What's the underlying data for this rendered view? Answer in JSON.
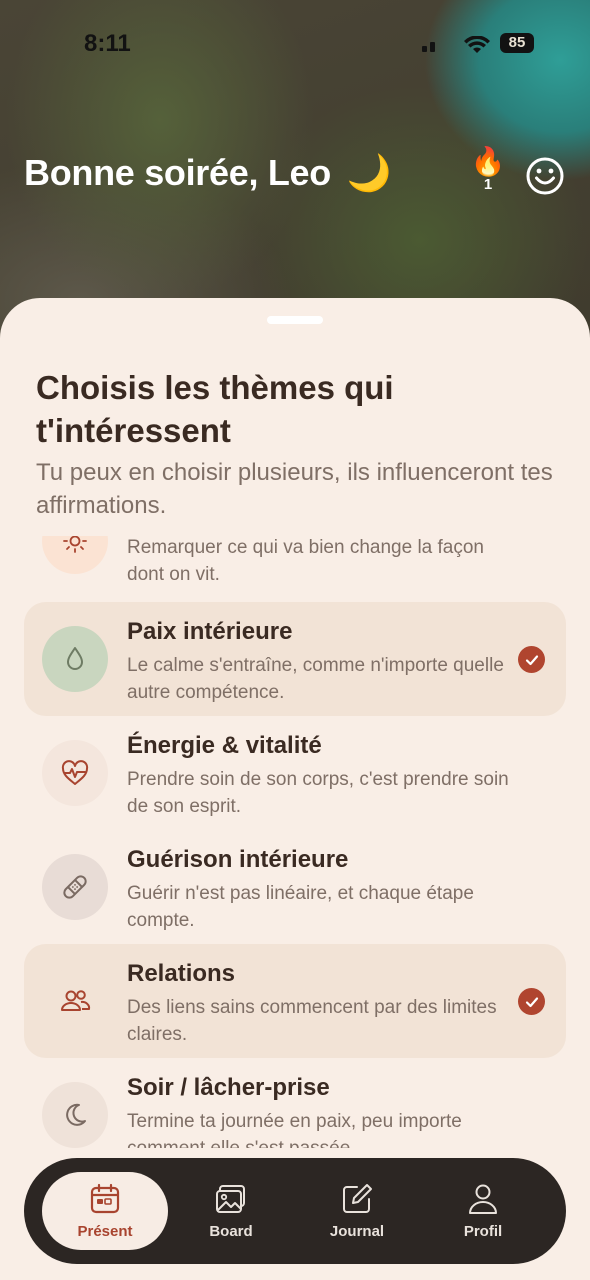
{
  "status_bar": {
    "time": "8:11",
    "battery": "85"
  },
  "header": {
    "greeting": "Bonne soirée, Leo",
    "moon_emoji": "🌙",
    "streak_emoji": "🔥",
    "streak_count": "1"
  },
  "sheet": {
    "title": "Choisis les thèmes qui t'intéressent",
    "subtitle": "Tu peux en choisir plusieurs, ils influenceront tes affirmations."
  },
  "themes": [
    {
      "name": "",
      "description": "Remarquer ce qui va bien change la façon dont on vit.",
      "icon": "sun-icon",
      "selected": false,
      "circle_color": "#fbe3d3"
    },
    {
      "name": "Paix intérieure",
      "description": "Le calme s'entraîne, comme n'importe quelle autre compétence.",
      "icon": "drop-icon",
      "selected": true,
      "circle_color": "#c9d6bf"
    },
    {
      "name": "Énergie & vitalité",
      "description": "Prendre soin de son corps, c'est prendre soin de son esprit.",
      "icon": "heartbeat-icon",
      "selected": false,
      "circle_color": "#f4e6dd"
    },
    {
      "name": "Guérison intérieure",
      "description": "Guérir n'est pas linéaire, et chaque étape compte.",
      "icon": "bandage-icon",
      "selected": false,
      "circle_color": "#e8dcd6"
    },
    {
      "name": "Relations",
      "description": "Des liens sains commencent par des limites claires.",
      "icon": "people-icon",
      "selected": true,
      "circle_color": "#f2e3d6"
    },
    {
      "name": "Soir / lâcher-prise",
      "description": "Termine ta journée en paix, peu importe comment elle s'est passée.",
      "icon": "moon-icon",
      "selected": false,
      "circle_color": "#efe2d9"
    }
  ],
  "tabbar": {
    "tabs": [
      {
        "label": "Présent",
        "icon": "calendar-icon",
        "active": true
      },
      {
        "label": "Board",
        "icon": "image-icon",
        "active": false
      },
      {
        "label": "Journal",
        "icon": "edit-icon",
        "active": false
      },
      {
        "label": "Profil",
        "icon": "user-icon",
        "active": false
      }
    ]
  },
  "colors": {
    "accent": "#b0452f",
    "sheet_bg": "#f9eee6",
    "selected_bg": "#f2e3d6",
    "text_dark": "#3a2a22",
    "text_muted": "#7f6f66",
    "tabbar_bg": "#2c2623"
  }
}
